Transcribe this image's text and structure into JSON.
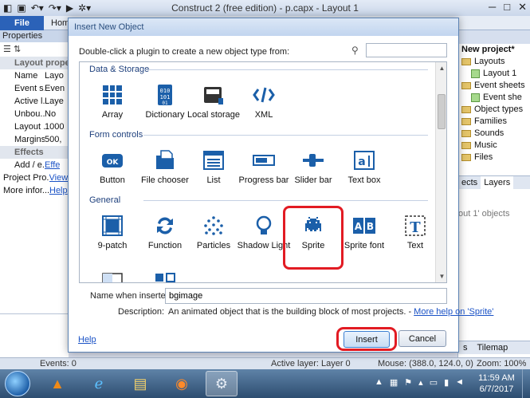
{
  "window": {
    "title": "Construct 2  (free edition) - p.capx - Layout 1"
  },
  "ribbon": {
    "file_tab": "File",
    "home_tab": "Hom"
  },
  "properties_panel": {
    "title": "Properties",
    "rows": [
      {
        "kind": "section",
        "name": "Layout proper",
        "value": ""
      },
      {
        "kind": "prop",
        "name": "Name",
        "value": "Layo"
      },
      {
        "kind": "prop",
        "name": "Event s...",
        "value": "Even"
      },
      {
        "kind": "prop",
        "name": "Active l...",
        "value": "Laye"
      },
      {
        "kind": "prop",
        "name": "Unbou...",
        "value": "No"
      },
      {
        "kind": "prop",
        "name": "Layout ...",
        "value": "1000"
      },
      {
        "kind": "prop",
        "name": "Margins",
        "value": "500,"
      },
      {
        "kind": "section",
        "name": "Effects",
        "value": ""
      },
      {
        "kind": "prop",
        "name": "Add / e...",
        "value": "Effe",
        "link": true
      },
      {
        "kind": "mini",
        "name": "Project Pro...",
        "value": "View",
        "link": true
      },
      {
        "kind": "mini",
        "name": "More infor...",
        "value": "Help",
        "link": true
      }
    ]
  },
  "project_panel": {
    "items": [
      {
        "label": "New project*",
        "indent": 4,
        "icon": "none",
        "bold": true
      },
      {
        "label": "Layouts",
        "indent": 4,
        "icon": "folder"
      },
      {
        "label": "Layout 1",
        "indent": 16,
        "icon": "layout"
      },
      {
        "label": "Event sheets",
        "indent": 4,
        "icon": "folder"
      },
      {
        "label": "Event she",
        "indent": 16,
        "icon": "layout"
      },
      {
        "label": "Object types",
        "indent": 4,
        "icon": "folder"
      },
      {
        "label": "Families",
        "indent": 4,
        "icon": "folder"
      },
      {
        "label": "Sounds",
        "indent": 4,
        "icon": "folder"
      },
      {
        "label": "Music",
        "indent": 4,
        "icon": "folder"
      },
      {
        "label": "Files",
        "indent": 4,
        "icon": "folder"
      }
    ],
    "tabs": [
      "ects",
      "Layers"
    ],
    "objects_hint": "out 1' objects",
    "bottom_tabs": [
      "s",
      "Tilemap"
    ]
  },
  "status": {
    "events": "Events: 0",
    "active_layer": "Active layer: Layer 0",
    "mouse": "Mouse: (388.0, 124.0, 0)",
    "zoom": "Zoom: 100%"
  },
  "taskbar": {
    "time": "11:59 AM",
    "date": "6/7/2017"
  },
  "dialog": {
    "title": "Insert New Object",
    "instruction": "Double-click a plugin to create a new object type from:",
    "search_value": "",
    "categories": [
      {
        "name": "Data & Storage",
        "plugins": [
          {
            "label": "Array",
            "icon": "array",
            "color": "#1b5fa9"
          },
          {
            "label": "Dictionary",
            "icon": "dictionary",
            "color": "#1b5fa9"
          },
          {
            "label": "Local storage",
            "icon": "local-storage",
            "color": "#333333"
          },
          {
            "label": "XML",
            "icon": "xml",
            "color": "#1b5fa9"
          }
        ]
      },
      {
        "name": "Form controls",
        "plugins": [
          {
            "label": "Button",
            "icon": "button",
            "color": "#1b5fa9"
          },
          {
            "label": "File chooser",
            "icon": "file-chooser",
            "color": "#1b5fa9"
          },
          {
            "label": "List",
            "icon": "list",
            "color": "#1b5fa9"
          },
          {
            "label": "Progress bar",
            "icon": "progress-bar",
            "color": "#1b5fa9"
          },
          {
            "label": "Slider bar",
            "icon": "slider-bar",
            "color": "#1b5fa9"
          },
          {
            "label": "Text box",
            "icon": "text-box",
            "color": "#1b5fa9"
          }
        ]
      },
      {
        "name": "General",
        "plugins": [
          {
            "label": "9-patch",
            "icon": "nine-patch",
            "color": "#1b5fa9"
          },
          {
            "label": "Function",
            "icon": "function",
            "color": "#1b5fa9"
          },
          {
            "label": "Particles",
            "icon": "particles",
            "color": "#1b5fa9"
          },
          {
            "label": "Shadow Light",
            "icon": "shadow-light",
            "color": "#1b5fa9"
          },
          {
            "label": "Sprite",
            "icon": "sprite",
            "color": "#1b5fa9",
            "selected": true
          },
          {
            "label": "Sprite font",
            "icon": "sprite-font",
            "color": "#1b5fa9"
          },
          {
            "label": "Text",
            "icon": "text",
            "color": "#1b5fa9"
          },
          {
            "label": "Tiled",
            "icon": "tiled",
            "color": "#1b5fa9"
          },
          {
            "label": "Tilemap",
            "icon": "tilemap",
            "color": "#1b5fa9"
          }
        ]
      }
    ],
    "name_label": "Name when inserted:",
    "name_value": "bgimage",
    "description_label": "Description:",
    "description_text": "An animated object that is the building block of most projects. - ",
    "description_link": "More help on 'Sprite'",
    "help_link": "Help",
    "insert_button": "Insert",
    "cancel_button": "Cancel"
  }
}
